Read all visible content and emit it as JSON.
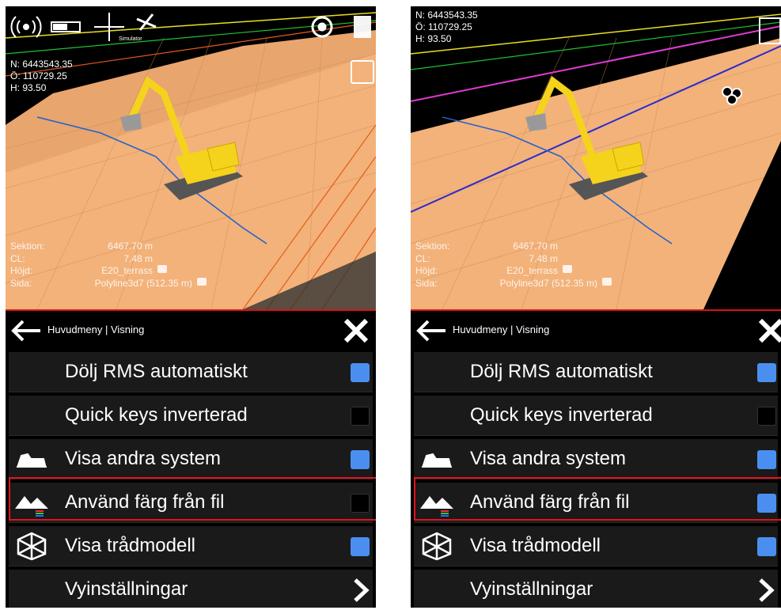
{
  "panels": [
    {
      "id": "before",
      "coords": {
        "n": "N: 6443543.35",
        "o": "Ö: 110729.25",
        "h": "H: 93.50"
      },
      "status": {
        "simulator_label": "Simulator"
      },
      "section": [
        {
          "key": "Sektion:",
          "value": "6467.70 m"
        },
        {
          "key": "CL:",
          "value": "7.48 m"
        },
        {
          "key": "Höjd:",
          "value": "E20_terrass"
        },
        {
          "key": "Sida:",
          "value": "Polyline3d7 (512.35 m)"
        }
      ],
      "menu": {
        "breadcrumb": "Huvudmeny | Visning",
        "items": [
          {
            "label": "Dölj RMS automatiskt",
            "checked": true
          },
          {
            "label": "Quick keys  inverterad",
            "checked": false
          },
          {
            "label": "Visa andra system",
            "checked": true
          },
          {
            "label": "Använd färg från fil",
            "checked": false
          },
          {
            "label": "Visa trådmodell",
            "checked": true
          },
          {
            "label": "Vyinställningar"
          }
        ]
      }
    },
    {
      "id": "after",
      "coords": {
        "n": "N: 6443543.35",
        "o": "Ö: 110729.25",
        "h": "H: 93.50"
      },
      "section": [
        {
          "key": "Sektion:",
          "value": "6467.70 m"
        },
        {
          "key": "CL:",
          "value": "7.48 m"
        },
        {
          "key": "Höjd:",
          "value": "E20_terrass"
        },
        {
          "key": "Sida:",
          "value": "Polyline3d7 (512.35 m)"
        }
      ],
      "menu": {
        "breadcrumb": "Huvudmeny | Visning",
        "items": [
          {
            "label": "Dölj RMS automatiskt",
            "checked": true
          },
          {
            "label": "Quick keys  inverterad",
            "checked": false
          },
          {
            "label": "Visa andra system",
            "checked": true
          },
          {
            "label": "Använd färg från fil",
            "checked": true
          },
          {
            "label": "Visa trådmodell",
            "checked": true
          },
          {
            "label": "Vyinställningar"
          }
        ]
      }
    }
  ],
  "colors": {
    "checkbox_on": "#4a8ff0",
    "highlight": "#e0141e",
    "terrain": "#f2b27a",
    "excavator": "#f5d21c"
  },
  "icons": [
    "wifi-signal-icon",
    "battery-icon",
    "level-icon",
    "gps-satellite-icon",
    "target-icon",
    "layers-icon",
    "cube-view-icon",
    "back-arrow-icon",
    "close-icon",
    "excavator-icon",
    "mountain-color-icon",
    "wireframe-cube-icon",
    "chevron-right-icon"
  ]
}
